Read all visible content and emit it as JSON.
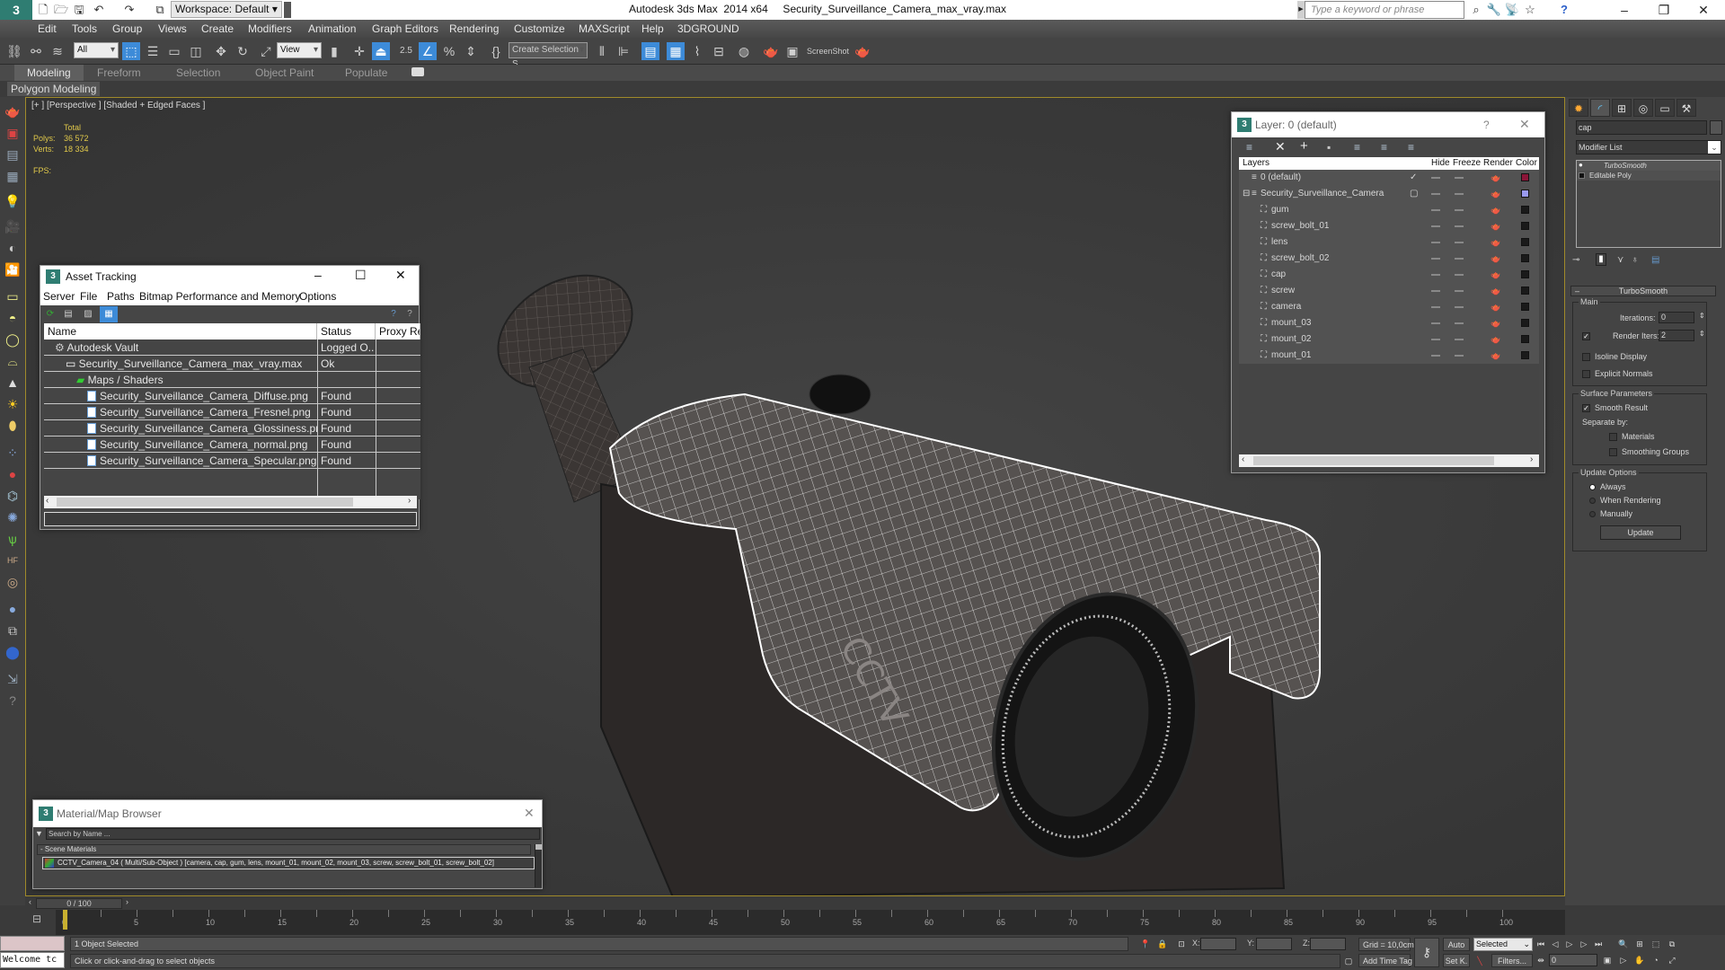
{
  "app": {
    "window_title": "Autodesk 3ds Max  2014 x64     Security_Surveillance_Camera_max_vray.max",
    "workspace": "Workspace: Default",
    "search_placeholder": "Type a keyword or phrase",
    "logo_glyph": "3"
  },
  "menu": [
    "Edit",
    "Tools",
    "Group",
    "Views",
    "Create",
    "Modifiers",
    "Animation",
    "Graph Editors",
    "Rendering",
    "Customize",
    "MAXScript",
    "Help",
    "3DGROUND"
  ],
  "toolbar": {
    "selection_filter": "All",
    "ref_coord": "View",
    "named_selection": "Create Selection S",
    "snap_value": "2.5",
    "screenshot_label": "ScreenShot",
    "icons": [
      "link-icon",
      "unlink-icon",
      "bind-spacewarp-icon",
      "select-object-icon",
      "select-by-name-icon",
      "rect-selection-icon",
      "window-crossing-icon",
      "move-icon",
      "rotate-icon",
      "scale-icon",
      "pivot-icon",
      "manipulate-icon",
      "keyboard-shortcut-icon",
      "snap-toggle-icon",
      "angle-snap-icon",
      "percent-snap-icon",
      "spinner-snap-icon",
      "edit-named-sel-icon",
      "mirror-icon",
      "align-icon",
      "layer-manager-icon",
      "graphite-icon",
      "curve-editor-icon",
      "schematic-icon",
      "material-editor-icon",
      "render-setup-icon",
      "rendered-frame-icon",
      "render-icon"
    ]
  },
  "ribbon": {
    "tabs": [
      "Modeling",
      "Freeform",
      "Selection",
      "Object Paint",
      "Populate"
    ],
    "active_tab": "Modeling",
    "sub_label": "Polygon Modeling"
  },
  "viewport": {
    "label": "[+ ] [Perspective ] [Shaded + Edged Faces ]",
    "stats": {
      "header": "Total",
      "polys_label": "Polys:",
      "polys": "36 572",
      "verts_label": "Verts:",
      "verts": "18 334",
      "fps_label": "FPS:"
    },
    "model_text": "CCTV"
  },
  "asset_tracking": {
    "title": "Asset Tracking",
    "menu": [
      "Server",
      "File",
      "Paths",
      "Bitmap Performance and Memory",
      "Options"
    ],
    "columns": [
      "Name",
      "Status",
      "Proxy Res"
    ],
    "rows": [
      {
        "name": "Autodesk Vault",
        "status": "Logged O...",
        "indent": 1,
        "icon": "vault-icon"
      },
      {
        "name": "Security_Surveillance_Camera_max_vray.max",
        "status": "Ok",
        "indent": 2,
        "icon": "max-file-icon"
      },
      {
        "name": "Maps / Shaders",
        "status": "",
        "indent": 3,
        "icon": "maps-icon"
      },
      {
        "name": "Security_Surveillance_Camera_Diffuse.png",
        "status": "Found",
        "indent": 4,
        "icon": "image-file-icon"
      },
      {
        "name": "Security_Surveillance_Camera_Fresnel.png",
        "status": "Found",
        "indent": 4,
        "icon": "image-file-icon"
      },
      {
        "name": "Security_Surveillance_Camera_Glossiness.png",
        "status": "Found",
        "indent": 4,
        "icon": "image-file-icon"
      },
      {
        "name": "Security_Surveillance_Camera_normal.png",
        "status": "Found",
        "indent": 4,
        "icon": "image-file-icon"
      },
      {
        "name": "Security_Surveillance_Camera_Specular.png",
        "status": "Found",
        "indent": 4,
        "icon": "image-file-icon"
      }
    ]
  },
  "layer_window": {
    "title": "Layer: 0 (default)",
    "help": "?",
    "columns": [
      "Layers",
      "Hide",
      "Freeze",
      "Render",
      "Color"
    ],
    "rows": [
      {
        "name": "0 (default)",
        "level": 0,
        "current": "check",
        "color": "#8b1538"
      },
      {
        "name": "Security_Surveillance_Camera",
        "level": 0,
        "current": "box",
        "color": "#9a9af0",
        "expand": "⊟"
      },
      {
        "name": "gum",
        "level": 1,
        "color": "#1a1a1a"
      },
      {
        "name": "screw_bolt_01",
        "level": 1,
        "color": "#1a1a1a"
      },
      {
        "name": "lens",
        "level": 1,
        "color": "#1a1a1a"
      },
      {
        "name": "screw_bolt_02",
        "level": 1,
        "color": "#1a1a1a"
      },
      {
        "name": "cap",
        "level": 1,
        "color": "#1a1a1a"
      },
      {
        "name": "screw",
        "level": 1,
        "color": "#1a1a1a"
      },
      {
        "name": "camera",
        "level": 1,
        "color": "#1a1a1a"
      },
      {
        "name": "mount_03",
        "level": 1,
        "color": "#1a1a1a"
      },
      {
        "name": "mount_02",
        "level": 1,
        "color": "#1a1a1a"
      },
      {
        "name": "mount_01",
        "level": 1,
        "color": "#1a1a1a"
      }
    ]
  },
  "command_panel": {
    "object_name": "cap",
    "modifier_list": "Modifier List",
    "stack": [
      "TurboSmooth",
      "Editable Poly"
    ],
    "rollout_title": "TurboSmooth",
    "main_group": "Main",
    "iterations_label": "Iterations:",
    "iterations": "0",
    "render_iters_label": "Render Iters:",
    "render_iters": "2",
    "render_iters_checked": true,
    "isoline_label": "Isoline Display",
    "isoline_checked": false,
    "explicit_normals_label": "Explicit Normals",
    "explicit_normals_checked": false,
    "surface_group": "Surface Parameters",
    "smooth_result_label": "Smooth Result",
    "smooth_result_checked": true,
    "separate_by_label": "Separate by:",
    "materials_label": "Materials",
    "smoothing_groups_label": "Smoothing Groups",
    "update_group": "Update Options",
    "update_options": [
      "Always",
      "When Rendering",
      "Manually"
    ],
    "update_selected": "Always",
    "update_button": "Update"
  },
  "material_browser": {
    "title": "Material/Map Browser",
    "search_placeholder": "Search by Name ...",
    "section": "- Scene Materials",
    "material": "CCTV_Camera_04  ( Multi/Sub-Object ) [camera, cap, gum, lens, mount_01, mount_02, mount_03, screw, screw_bolt_01, screw_bolt_02]"
  },
  "timeline": {
    "frame_display": "0 / 100",
    "current_frame": 0,
    "start": 0,
    "end": 100,
    "labels": [
      0,
      5,
      10,
      15,
      20,
      25,
      30,
      35,
      40,
      45,
      50,
      55,
      60,
      65,
      70,
      75,
      80,
      85,
      90,
      95,
      100
    ]
  },
  "status": {
    "maxscript_listener": "Welcome tc",
    "selection_info": "1 Object Selected",
    "prompt": "Click or click-and-drag to select objects",
    "x_label": "X:",
    "y_label": "Y:",
    "z_label": "Z:",
    "grid": "Grid = 10,0cm",
    "add_time_tag": "Add Time Tag",
    "auto_key": "Auto",
    "set_key": "Set K.",
    "key_filter": "Selected",
    "filters": "Filters...",
    "frame_field": "0"
  }
}
